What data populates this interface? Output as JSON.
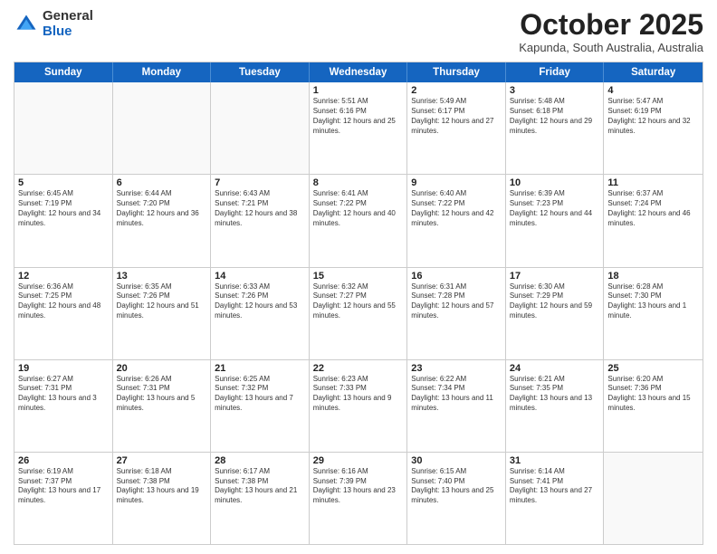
{
  "logo": {
    "general": "General",
    "blue": "Blue"
  },
  "header": {
    "month": "October 2025",
    "location": "Kapunda, South Australia, Australia"
  },
  "weekdays": [
    "Sunday",
    "Monday",
    "Tuesday",
    "Wednesday",
    "Thursday",
    "Friday",
    "Saturday"
  ],
  "rows": [
    [
      {
        "day": "",
        "sunrise": "",
        "sunset": "",
        "daylight": ""
      },
      {
        "day": "",
        "sunrise": "",
        "sunset": "",
        "daylight": ""
      },
      {
        "day": "",
        "sunrise": "",
        "sunset": "",
        "daylight": ""
      },
      {
        "day": "1",
        "sunrise": "Sunrise: 5:51 AM",
        "sunset": "Sunset: 6:16 PM",
        "daylight": "Daylight: 12 hours and 25 minutes."
      },
      {
        "day": "2",
        "sunrise": "Sunrise: 5:49 AM",
        "sunset": "Sunset: 6:17 PM",
        "daylight": "Daylight: 12 hours and 27 minutes."
      },
      {
        "day": "3",
        "sunrise": "Sunrise: 5:48 AM",
        "sunset": "Sunset: 6:18 PM",
        "daylight": "Daylight: 12 hours and 29 minutes."
      },
      {
        "day": "4",
        "sunrise": "Sunrise: 5:47 AM",
        "sunset": "Sunset: 6:19 PM",
        "daylight": "Daylight: 12 hours and 32 minutes."
      }
    ],
    [
      {
        "day": "5",
        "sunrise": "Sunrise: 6:45 AM",
        "sunset": "Sunset: 7:19 PM",
        "daylight": "Daylight: 12 hours and 34 minutes."
      },
      {
        "day": "6",
        "sunrise": "Sunrise: 6:44 AM",
        "sunset": "Sunset: 7:20 PM",
        "daylight": "Daylight: 12 hours and 36 minutes."
      },
      {
        "day": "7",
        "sunrise": "Sunrise: 6:43 AM",
        "sunset": "Sunset: 7:21 PM",
        "daylight": "Daylight: 12 hours and 38 minutes."
      },
      {
        "day": "8",
        "sunrise": "Sunrise: 6:41 AM",
        "sunset": "Sunset: 7:22 PM",
        "daylight": "Daylight: 12 hours and 40 minutes."
      },
      {
        "day": "9",
        "sunrise": "Sunrise: 6:40 AM",
        "sunset": "Sunset: 7:22 PM",
        "daylight": "Daylight: 12 hours and 42 minutes."
      },
      {
        "day": "10",
        "sunrise": "Sunrise: 6:39 AM",
        "sunset": "Sunset: 7:23 PM",
        "daylight": "Daylight: 12 hours and 44 minutes."
      },
      {
        "day": "11",
        "sunrise": "Sunrise: 6:37 AM",
        "sunset": "Sunset: 7:24 PM",
        "daylight": "Daylight: 12 hours and 46 minutes."
      }
    ],
    [
      {
        "day": "12",
        "sunrise": "Sunrise: 6:36 AM",
        "sunset": "Sunset: 7:25 PM",
        "daylight": "Daylight: 12 hours and 48 minutes."
      },
      {
        "day": "13",
        "sunrise": "Sunrise: 6:35 AM",
        "sunset": "Sunset: 7:26 PM",
        "daylight": "Daylight: 12 hours and 51 minutes."
      },
      {
        "day": "14",
        "sunrise": "Sunrise: 6:33 AM",
        "sunset": "Sunset: 7:26 PM",
        "daylight": "Daylight: 12 hours and 53 minutes."
      },
      {
        "day": "15",
        "sunrise": "Sunrise: 6:32 AM",
        "sunset": "Sunset: 7:27 PM",
        "daylight": "Daylight: 12 hours and 55 minutes."
      },
      {
        "day": "16",
        "sunrise": "Sunrise: 6:31 AM",
        "sunset": "Sunset: 7:28 PM",
        "daylight": "Daylight: 12 hours and 57 minutes."
      },
      {
        "day": "17",
        "sunrise": "Sunrise: 6:30 AM",
        "sunset": "Sunset: 7:29 PM",
        "daylight": "Daylight: 12 hours and 59 minutes."
      },
      {
        "day": "18",
        "sunrise": "Sunrise: 6:28 AM",
        "sunset": "Sunset: 7:30 PM",
        "daylight": "Daylight: 13 hours and 1 minute."
      }
    ],
    [
      {
        "day": "19",
        "sunrise": "Sunrise: 6:27 AM",
        "sunset": "Sunset: 7:31 PM",
        "daylight": "Daylight: 13 hours and 3 minutes."
      },
      {
        "day": "20",
        "sunrise": "Sunrise: 6:26 AM",
        "sunset": "Sunset: 7:31 PM",
        "daylight": "Daylight: 13 hours and 5 minutes."
      },
      {
        "day": "21",
        "sunrise": "Sunrise: 6:25 AM",
        "sunset": "Sunset: 7:32 PM",
        "daylight": "Daylight: 13 hours and 7 minutes."
      },
      {
        "day": "22",
        "sunrise": "Sunrise: 6:23 AM",
        "sunset": "Sunset: 7:33 PM",
        "daylight": "Daylight: 13 hours and 9 minutes."
      },
      {
        "day": "23",
        "sunrise": "Sunrise: 6:22 AM",
        "sunset": "Sunset: 7:34 PM",
        "daylight": "Daylight: 13 hours and 11 minutes."
      },
      {
        "day": "24",
        "sunrise": "Sunrise: 6:21 AM",
        "sunset": "Sunset: 7:35 PM",
        "daylight": "Daylight: 13 hours and 13 minutes."
      },
      {
        "day": "25",
        "sunrise": "Sunrise: 6:20 AM",
        "sunset": "Sunset: 7:36 PM",
        "daylight": "Daylight: 13 hours and 15 minutes."
      }
    ],
    [
      {
        "day": "26",
        "sunrise": "Sunrise: 6:19 AM",
        "sunset": "Sunset: 7:37 PM",
        "daylight": "Daylight: 13 hours and 17 minutes."
      },
      {
        "day": "27",
        "sunrise": "Sunrise: 6:18 AM",
        "sunset": "Sunset: 7:38 PM",
        "daylight": "Daylight: 13 hours and 19 minutes."
      },
      {
        "day": "28",
        "sunrise": "Sunrise: 6:17 AM",
        "sunset": "Sunset: 7:38 PM",
        "daylight": "Daylight: 13 hours and 21 minutes."
      },
      {
        "day": "29",
        "sunrise": "Sunrise: 6:16 AM",
        "sunset": "Sunset: 7:39 PM",
        "daylight": "Daylight: 13 hours and 23 minutes."
      },
      {
        "day": "30",
        "sunrise": "Sunrise: 6:15 AM",
        "sunset": "Sunset: 7:40 PM",
        "daylight": "Daylight: 13 hours and 25 minutes."
      },
      {
        "day": "31",
        "sunrise": "Sunrise: 6:14 AM",
        "sunset": "Sunset: 7:41 PM",
        "daylight": "Daylight: 13 hours and 27 minutes."
      },
      {
        "day": "",
        "sunrise": "",
        "sunset": "",
        "daylight": ""
      }
    ]
  ]
}
